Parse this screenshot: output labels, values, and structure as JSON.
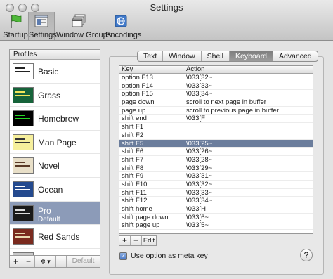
{
  "window": {
    "title": "Settings"
  },
  "toolbar": {
    "items": [
      {
        "label": "Startup",
        "icon": "flag-icon"
      },
      {
        "label": "Settings",
        "icon": "settings-window-icon",
        "selected": true
      },
      {
        "label": "Window Groups",
        "icon": "window-groups-icon"
      },
      {
        "label": "Encodings",
        "icon": "encodings-icon"
      }
    ]
  },
  "profiles": {
    "header": "Profiles",
    "items": [
      {
        "name": "Basic",
        "bg": "#ffffff",
        "fg": "#222222"
      },
      {
        "name": "Grass",
        "bg": "#16633a",
        "fg": "#f2e65a"
      },
      {
        "name": "Homebrew",
        "bg": "#000000",
        "fg": "#27d827"
      },
      {
        "name": "Man Page",
        "bg": "#f6ef9c",
        "fg": "#333333"
      },
      {
        "name": "Novel",
        "bg": "#e8dfc8",
        "fg": "#5a3a26"
      },
      {
        "name": "Ocean",
        "bg": "#244a8f",
        "fg": "#ffffff"
      },
      {
        "name": "Pro",
        "subtitle": "Default",
        "bg": "#1a1a1a",
        "fg": "#dddddd",
        "selected": true
      },
      {
        "name": "Red Sands",
        "bg": "#7a2a1e",
        "fg": "#e8d9b0"
      },
      {
        "name": "",
        "bg": "#c9c9c9",
        "fg": "#888888"
      }
    ],
    "buttons": {
      "add": "+",
      "remove": "−",
      "action": "✲ ▾",
      "default": "Default"
    }
  },
  "tabs": [
    {
      "label": "Text"
    },
    {
      "label": "Window"
    },
    {
      "label": "Shell"
    },
    {
      "label": "Keyboard",
      "active": true
    },
    {
      "label": "Advanced"
    }
  ],
  "keyboard": {
    "columns": {
      "key": "Key",
      "action": "Action"
    },
    "rows": [
      {
        "key": "option F13",
        "action": "\\033[32~"
      },
      {
        "key": "option F14",
        "action": "\\033[33~"
      },
      {
        "key": "option F15",
        "action": "\\033[34~"
      },
      {
        "key": "page down",
        "action": "scroll to next page in buffer"
      },
      {
        "key": "page up",
        "action": "scroll to previous page in buffer"
      },
      {
        "key": "shift end",
        "action": "\\033[F"
      },
      {
        "key": "shift F1",
        "action": ""
      },
      {
        "key": "shift F2",
        "action": ""
      },
      {
        "key": "shift F5",
        "action": "\\033[25~",
        "selected": true
      },
      {
        "key": "shift F6",
        "action": "\\033[26~"
      },
      {
        "key": "shift F7",
        "action": "\\033[28~"
      },
      {
        "key": "shift F8",
        "action": "\\033[29~"
      },
      {
        "key": "shift F9",
        "action": "\\033[31~"
      },
      {
        "key": "shift F10",
        "action": "\\033[32~"
      },
      {
        "key": "shift F11",
        "action": "\\033[33~"
      },
      {
        "key": "shift F12",
        "action": "\\033[34~"
      },
      {
        "key": "shift home",
        "action": "\\033[H"
      },
      {
        "key": "shift page down",
        "action": "\\033[6~"
      },
      {
        "key": "shift page up",
        "action": "\\033[5~"
      }
    ],
    "buttons": {
      "add": "+",
      "remove": "−",
      "edit": "Edit"
    },
    "meta_option": {
      "label": "Use option as meta key",
      "checked": true
    },
    "help": "?"
  }
}
